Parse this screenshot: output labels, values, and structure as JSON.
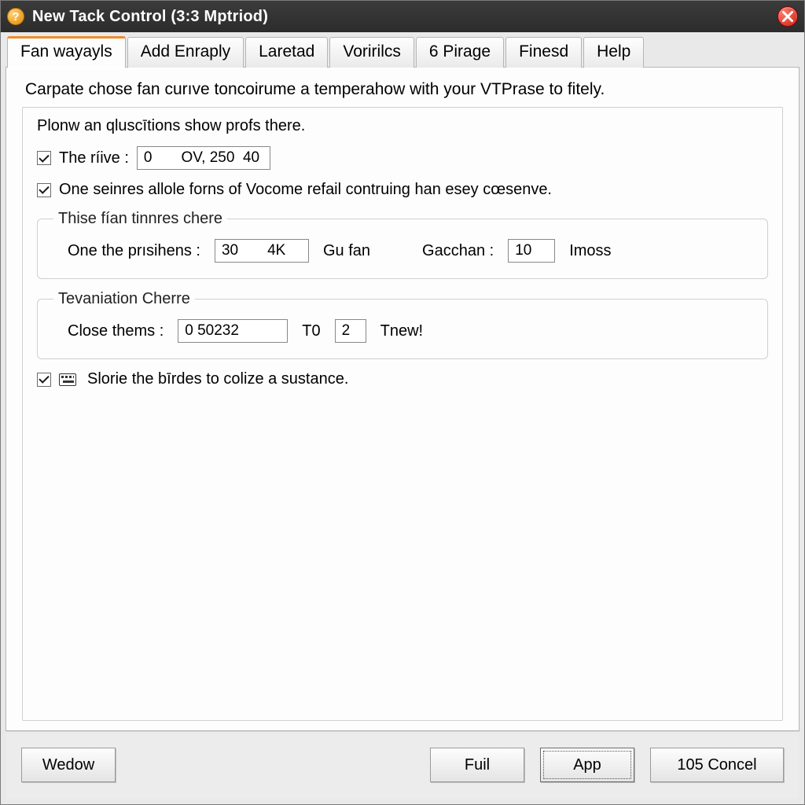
{
  "titlebar": {
    "app_icon_glyph": "?",
    "title": "New Tack Control (3:3 Mptriod)"
  },
  "tabs": [
    {
      "label": "Fan wayayls",
      "active": true
    },
    {
      "label": "Add Enraply"
    },
    {
      "label": "Laretad"
    },
    {
      "label": "Voririlcs"
    },
    {
      "label": "6 Pirage"
    },
    {
      "label": "Finesd"
    },
    {
      "label": "Help"
    }
  ],
  "panel": {
    "description": "Carpate chose fan curıve toncoirume a temperahow with your VTPrase to fitely.",
    "line1_text": "Plonw an qluscītions show profs there.",
    "cb_rive_label": "The ríive  :",
    "rive_value": "0       OV, 250  40",
    "cb_seinres_label": "One seinres allole forns of Vocome refail contruing han esey cœsenve.",
    "group1": {
      "legend": "Thise fían tinnres chere",
      "label_prsihers": "One the prısihens :",
      "value_prsihers": "30       4K",
      "after_prsihers": "Gu fan",
      "label_gacchan": "Gacchan :",
      "value_gacchan": "10",
      "after_gacchan": "Imoss"
    },
    "group2": {
      "legend": "Tevaniation Cherre",
      "label_close": "Close thems :",
      "value_close": "0 50232",
      "mid_text": "T0",
      "value_t0": "2",
      "after_t0": "Tnew!"
    },
    "cb_slorie_label": "Slorie the bīrdes to colize a sustance."
  },
  "buttons": {
    "wedow": "Wedow",
    "fuil": "Fuil",
    "app": "App",
    "cancel": "105 Concel"
  },
  "colors": {
    "accent_orange": "#f08c2e",
    "titlebar_bg": "#2c2c2c",
    "close_red": "#cc1e0f"
  }
}
